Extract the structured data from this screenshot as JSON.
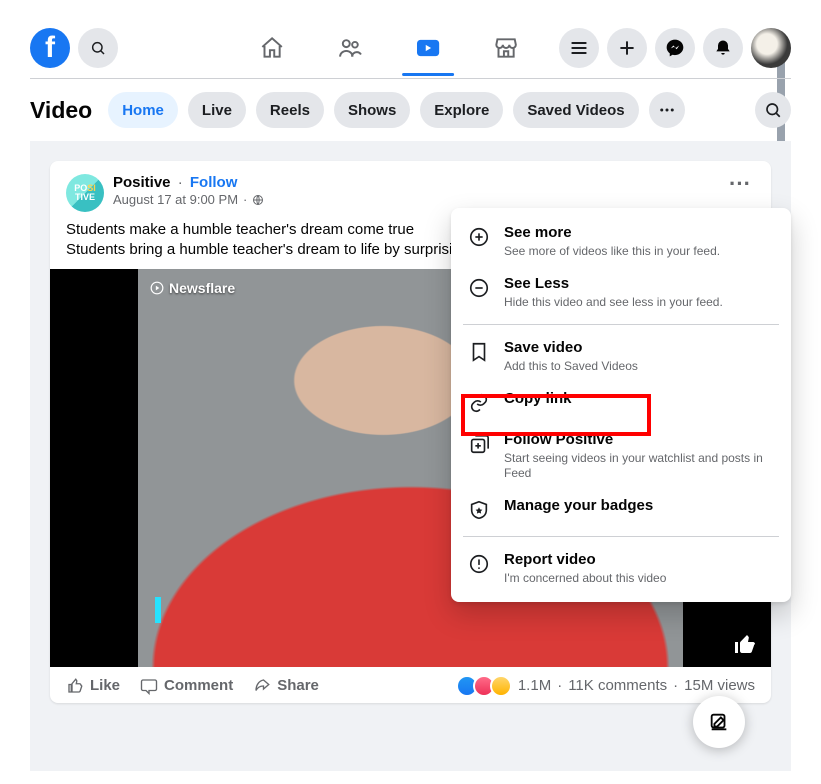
{
  "header": {
    "logo_letter": "f"
  },
  "vidnav": {
    "title": "Video",
    "tabs": [
      "Home",
      "Live",
      "Reels",
      "Shows",
      "Explore",
      "Saved Videos"
    ]
  },
  "post": {
    "page_name": "Positive",
    "follow_label": "Follow",
    "timestamp": "August 17 at 9:00 PM",
    "caption_line1": "Students make a humble teacher's dream come true",
    "caption_line2": "Students bring a humble teacher's dream to life by surprising him",
    "watermark": "Newsflare",
    "actions": {
      "like": "Like",
      "comment": "Comment",
      "share": "Share"
    },
    "stats": {
      "reactions": "1.1M",
      "comments": "11K comments",
      "views": "15M views"
    }
  },
  "menu": {
    "see_more": {
      "title": "See more",
      "desc": "See more of videos like this in your feed."
    },
    "see_less": {
      "title": "See Less",
      "desc": "Hide this video and see less in your feed."
    },
    "save": {
      "title": "Save video",
      "desc": "Add this to Saved Videos"
    },
    "copy": {
      "title": "Copy link"
    },
    "follow": {
      "title": "Follow Positive",
      "desc": "Start seeing videos in your watchlist and posts in Feed"
    },
    "badges": {
      "title": "Manage your badges"
    },
    "report": {
      "title": "Report video",
      "desc": "I'm concerned about this video"
    }
  }
}
